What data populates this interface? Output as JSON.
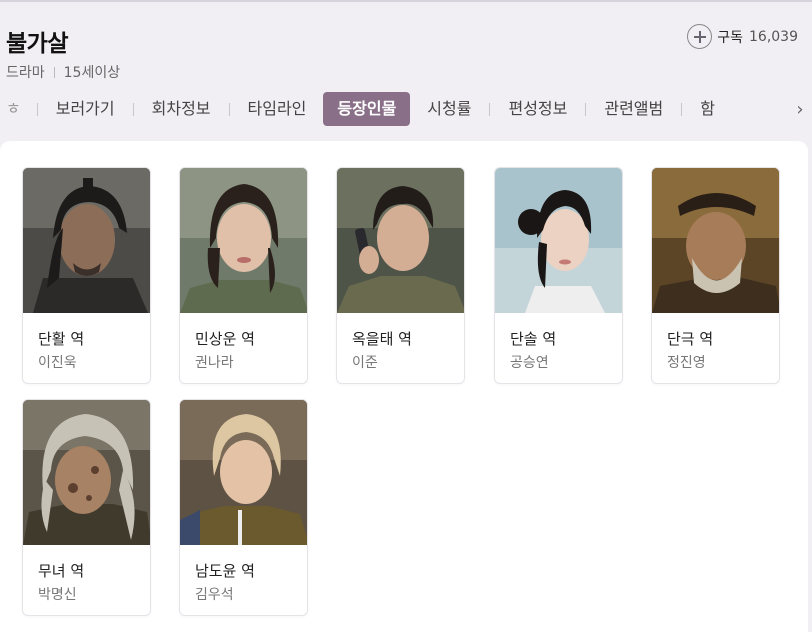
{
  "header": {
    "title": "불가살",
    "genre": "드라마",
    "rating": "15세이상",
    "subscribe_label": "구독",
    "subscribe_count": "16,039"
  },
  "tabs": {
    "prev_fragment": "ㅎ",
    "items": [
      {
        "label": "보러가기",
        "active": false
      },
      {
        "label": "회차정보",
        "active": false
      },
      {
        "label": "타임라인",
        "active": false
      },
      {
        "label": "등장인물",
        "active": true
      },
      {
        "label": "시청률",
        "active": false
      },
      {
        "label": "편성정보",
        "active": false
      },
      {
        "label": "관련앨범",
        "active": false
      },
      {
        "label": "함",
        "active": false
      }
    ]
  },
  "cast": [
    {
      "role": "단활 역",
      "actor": "이진욱"
    },
    {
      "role": "민상운 역",
      "actor": "권나라"
    },
    {
      "role": "옥을태 역",
      "actor": "이준"
    },
    {
      "role": "단솔 역",
      "actor": "공승연"
    },
    {
      "role": "단극 역",
      "actor": "정진영"
    },
    {
      "role": "무녀 역",
      "actor": "박명신"
    },
    {
      "role": "남도윤 역",
      "actor": "김우석"
    }
  ],
  "colors": {
    "accent": "#8a6f88",
    "background": "#f1eff4"
  }
}
